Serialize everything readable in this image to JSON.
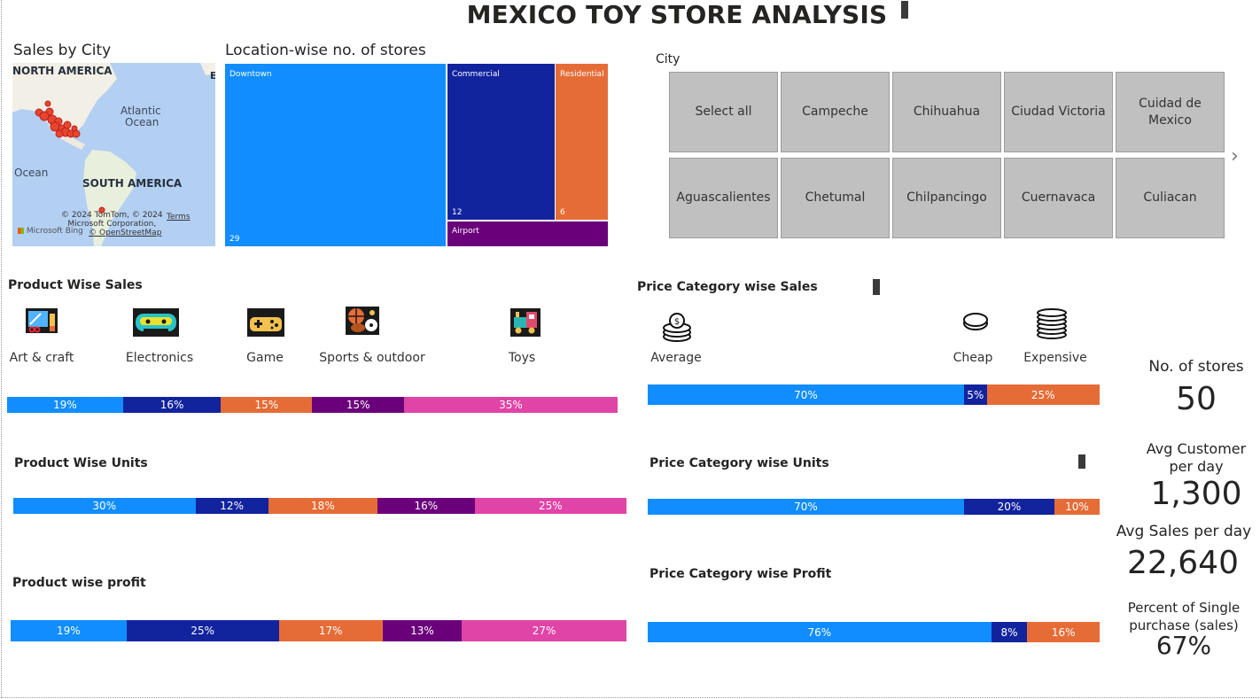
{
  "page_title": "MEXICO TOY STORE ANALYSIS",
  "colors": {
    "blue": "#118dff",
    "navy": "#12239e",
    "orange": "#e66c37",
    "purple": "#6b007b",
    "pink": "#e044a7",
    "slicer_grey": "#c0c0c0"
  },
  "map": {
    "title": "Sales by City",
    "labels": {
      "north_america": "NORTH AMERICA",
      "atlantic": "Atlantic",
      "ocean": "Ocean",
      "ocean_left": "Ocean",
      "south_america": "SOUTH AMERICA",
      "edge_letter": "E"
    },
    "copyright_line1": "© 2024 TomTom, © 2024",
    "copyright_line2": "Microsoft Corporation,",
    "copyright_line3": "© OpenStreetMap",
    "terms": "Terms",
    "bing": "Microsoft Bing"
  },
  "treemap": {
    "title": "Location-wise no. of stores",
    "cells": [
      {
        "label": "Downtown",
        "value": "29"
      },
      {
        "label": "Commercial",
        "value": "12"
      },
      {
        "label": "Residential",
        "value": "6"
      },
      {
        "label": "Airport",
        "value": ""
      }
    ]
  },
  "city_slicer": {
    "title": "City",
    "buttons": [
      "Select all",
      "Campeche",
      "Chihuahua",
      "Ciudad Victoria",
      "Cuidad de Mexico",
      "Aguascalientes",
      "Chetumal",
      "Chilpancingo",
      "Cuernavaca",
      "Culiacan"
    ],
    "next_icon": "chevron-right-icon"
  },
  "product_sales": {
    "title": "Product Wise Sales",
    "categories": [
      {
        "label": "Art & craft",
        "icon": "art-craft-icon"
      },
      {
        "label": "Electronics",
        "icon": "electronics-icon"
      },
      {
        "label": "Game",
        "icon": "game-controller-icon"
      },
      {
        "label": "Sports & outdoor",
        "icon": "sports-balls-icon"
      },
      {
        "label": "Toys",
        "icon": "toy-train-icon"
      }
    ]
  },
  "product_units": {
    "title": "Product Wise Units"
  },
  "product_profit": {
    "title": "Product wise profit"
  },
  "price_sales": {
    "title": "Price Category wise Sales",
    "categories": [
      {
        "label": "Average",
        "icon": "coins-stack-icon"
      },
      {
        "label": "Cheap",
        "icon": "single-coin-icon"
      },
      {
        "label": "Expensive",
        "icon": "coins-pile-icon"
      }
    ]
  },
  "price_units": {
    "title": "Price Category wise Units"
  },
  "price_profit": {
    "title": "Price Category wise Profit"
  },
  "chart_data": [
    {
      "type": "bar",
      "title": "Product Wise Sales",
      "stacked": "100%",
      "categories": [
        "Art & craft",
        "Electronics",
        "Game",
        "Sports & outdoor",
        "Toys"
      ],
      "values": [
        19,
        16,
        15,
        15,
        35
      ],
      "labels": [
        "19%",
        "16%",
        "15%",
        "15%",
        "35%"
      ]
    },
    {
      "type": "bar",
      "title": "Product Wise Units",
      "stacked": "100%",
      "categories": [
        "Art & craft",
        "Electronics",
        "Game",
        "Sports & outdoor",
        "Toys"
      ],
      "values": [
        30,
        12,
        18,
        16,
        25
      ],
      "labels": [
        "30%",
        "12%",
        "18%",
        "16%",
        "25%"
      ]
    },
    {
      "type": "bar",
      "title": "Product wise profit",
      "stacked": "100%",
      "categories": [
        "Art & craft",
        "Electronics",
        "Game",
        "Sports & outdoor",
        "Toys"
      ],
      "values": [
        19,
        25,
        17,
        13,
        27
      ],
      "labels": [
        "19%",
        "25%",
        "17%",
        "13%",
        "27%"
      ]
    },
    {
      "type": "bar",
      "title": "Price Category wise Sales",
      "stacked": "100%",
      "categories": [
        "Average",
        "Cheap",
        "Expensive"
      ],
      "values": [
        70,
        5,
        25
      ],
      "labels": [
        "70%",
        "5%",
        "25%"
      ]
    },
    {
      "type": "bar",
      "title": "Price Category wise Units",
      "stacked": "100%",
      "categories": [
        "Average",
        "Cheap",
        "Expensive"
      ],
      "values": [
        70,
        20,
        10
      ],
      "labels": [
        "70%",
        "20%",
        "10%"
      ]
    },
    {
      "type": "bar",
      "title": "Price Category wise Profit",
      "stacked": "100%",
      "categories": [
        "Average",
        "Cheap",
        "Expensive"
      ],
      "values": [
        76,
        8,
        16
      ],
      "labels": [
        "76%",
        "8%",
        "16%"
      ]
    }
  ],
  "kpis": [
    {
      "label": "No. of stores",
      "value": "50"
    },
    {
      "label": "Avg Customer per day",
      "value": "1,300"
    },
    {
      "label": "Avg Sales per day",
      "value": "22,640"
    },
    {
      "label": "Percent of Single purchase (sales)",
      "value": "67%"
    }
  ]
}
